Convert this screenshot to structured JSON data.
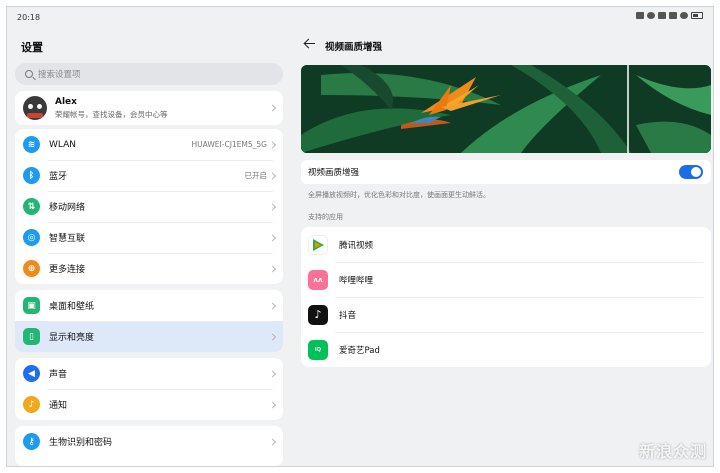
{
  "status_bar": {
    "time": "20:18",
    "icons": [
      "message-icon",
      "eye-icon",
      "signal-icon",
      "bluetooth-icon",
      "wifi-icon",
      "battery-icon"
    ]
  },
  "left": {
    "title": "设置",
    "search_placeholder": "搜索设置项",
    "profile": {
      "name": "Alex",
      "subtitle": "荣耀帐号，查找设备，会员中心等"
    },
    "groups": [
      [
        {
          "label": "WLAN",
          "value": "HUAWEI-CJ1EM5_5G",
          "icon": "wifi-icon",
          "color": "#1e9bf0"
        },
        {
          "label": "蓝牙",
          "value": "已开启",
          "icon": "bluetooth-icon",
          "color": "#1e9bf0"
        },
        {
          "label": "移动网络",
          "value": "",
          "icon": "mobile-network-icon",
          "color": "#22b573"
        },
        {
          "label": "智慧互联",
          "value": "",
          "icon": "smart-connect-icon",
          "color": "#1e9bf0"
        },
        {
          "label": "更多连接",
          "value": "",
          "icon": "more-connections-icon",
          "color": "#f08a1c"
        }
      ],
      [
        {
          "label": "桌面和壁纸",
          "value": "",
          "icon": "wallpaper-icon",
          "color": "#22b573"
        },
        {
          "label": "显示和亮度",
          "value": "",
          "icon": "display-icon",
          "color": "#22b573",
          "active": true
        }
      ],
      [
        {
          "label": "声音",
          "value": "",
          "icon": "sound-icon",
          "color": "#1e6ef0"
        },
        {
          "label": "通知",
          "value": "",
          "icon": "notification-icon",
          "color": "#f0a81c"
        }
      ],
      [
        {
          "label": "生物识别和密码",
          "value": "",
          "icon": "key-icon",
          "color": "#1e9bf0"
        }
      ]
    ]
  },
  "right": {
    "title": "视频画质增强",
    "toggle": {
      "label": "视频画质增强",
      "on": true
    },
    "description": "全屏播放视频时，优化色彩和对比度，使画面更生动鲜活。",
    "section_title": "支持的应用",
    "apps": [
      {
        "label": "腾讯视频",
        "icon": "tencent-video-icon",
        "color": "#ffffff"
      },
      {
        "label": "哔哩哔哩",
        "icon": "bilibili-icon",
        "color": "#fb7299"
      },
      {
        "label": "抖音",
        "icon": "douyin-icon",
        "color": "#111111"
      },
      {
        "label": "爱奇艺Pad",
        "icon": "iqiyi-icon",
        "color": "#00c05a"
      }
    ]
  },
  "watermark": "新浪众测"
}
